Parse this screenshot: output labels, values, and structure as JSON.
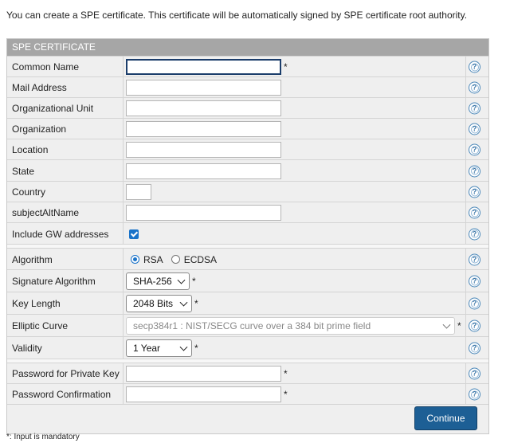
{
  "intro_text": "You can create a SPE certificate. This certificate will be automatically signed by SPE certificate root authority.",
  "panel_title": "SPE CERTIFICATE",
  "fields": {
    "common_name": {
      "label": "Common Name",
      "value": "",
      "required": "*"
    },
    "mail_address": {
      "label": "Mail Address",
      "value": ""
    },
    "organizational_unit": {
      "label": "Organizational Unit",
      "value": ""
    },
    "organization": {
      "label": "Organization",
      "value": ""
    },
    "location": {
      "label": "Location",
      "value": ""
    },
    "state": {
      "label": "State",
      "value": ""
    },
    "country": {
      "label": "Country",
      "value": ""
    },
    "subject_alt_name": {
      "label": "subjectAltName",
      "value": ""
    },
    "include_gw": {
      "label": "Include GW addresses",
      "checked": true
    }
  },
  "algorithm": {
    "label": "Algorithm",
    "options": [
      "RSA",
      "ECDSA"
    ],
    "selected": "RSA"
  },
  "signature_algorithm": {
    "label": "Signature Algorithm",
    "value": "SHA-256",
    "required": "*"
  },
  "key_length": {
    "label": "Key Length",
    "value": "2048 Bits",
    "required": "*"
  },
  "elliptic_curve": {
    "label": "Elliptic Curve",
    "value": "secp384r1 : NIST/SECG curve over a 384 bit prime field",
    "required": "*",
    "disabled": true
  },
  "validity": {
    "label": "Validity",
    "value": "1 Year",
    "required": "*"
  },
  "password_private_key": {
    "label": "Password for Private Key",
    "value": "",
    "required": "*"
  },
  "password_confirmation": {
    "label": "Password Confirmation",
    "value": "",
    "required": "*"
  },
  "help_icon_glyph": "?",
  "continue_label": "Continue",
  "footnote": "*: Input is mandatory",
  "colors": {
    "header_bg": "#a6a6a6",
    "accent": "#1a73c9",
    "button_bg": "#1d5f95",
    "panel_bg": "#efefef"
  }
}
